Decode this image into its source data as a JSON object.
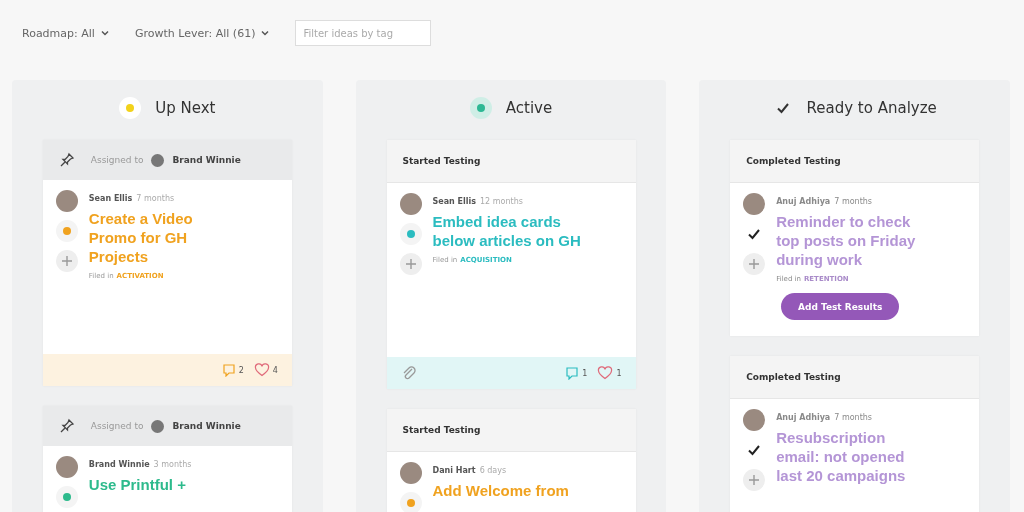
{
  "filters": [
    {
      "label": "Roadmap: All"
    },
    {
      "label": "Growth Lever: All (61)"
    }
  ],
  "tag_filter": {
    "placeholder": "Filter ideas by tag"
  },
  "columns": [
    {
      "title": "Up Next",
      "kind": "dot",
      "color": "#f2d21b",
      "cards": [
        {
          "kind": "assigned",
          "header": "Assigned to",
          "assignee": "Brand Winnie",
          "author": "Sean Ellis",
          "time": "7 months",
          "color": "#f0a21f",
          "title": "Create a Video Promo for GH Projects",
          "filed": "Filed in",
          "category": "ACTIVATION",
          "comments": "2",
          "likes": "4"
        },
        {
          "kind": "assigned",
          "header": "Assigned to",
          "assignee": "Brand Winnie",
          "author": "Brand Winnie",
          "time": "3 months",
          "color": "#2dba8c",
          "title": "Use Printful +"
        }
      ]
    },
    {
      "title": "Active",
      "kind": "dot",
      "color": "#2db894",
      "cards": [
        {
          "kind": "testing",
          "header": "Started Testing",
          "author": "Sean Ellis",
          "time": "12 months",
          "color": "#2bbcc0",
          "title": "Embed idea cards below articles on GH",
          "filed": "Filed in",
          "category": "ACQUISITION",
          "attachment": true,
          "comments": "1",
          "likes": "1"
        },
        {
          "kind": "testing",
          "header": "Started Testing",
          "author": "Dani Hart",
          "time": "6 days",
          "color": "#f0a21f",
          "title": "Add Welcome from"
        }
      ]
    },
    {
      "title": "Ready to Analyze",
      "kind": "check",
      "color": "#333333",
      "cards": [
        {
          "kind": "completed",
          "header": "Completed Testing",
          "author": "Anuj Adhiya",
          "time": "7 months",
          "color": "#b495d6",
          "title": "Reminder to check top posts on Friday during work",
          "filed": "Filed in",
          "category": "RETENTION",
          "action": "Add Test Results"
        },
        {
          "kind": "completed",
          "header": "Completed Testing",
          "author": "Anuj Adhiya",
          "time": "7 months",
          "color": "#b495d6",
          "title": "Resubscription email: not opened last 20 campaigns"
        }
      ]
    }
  ]
}
